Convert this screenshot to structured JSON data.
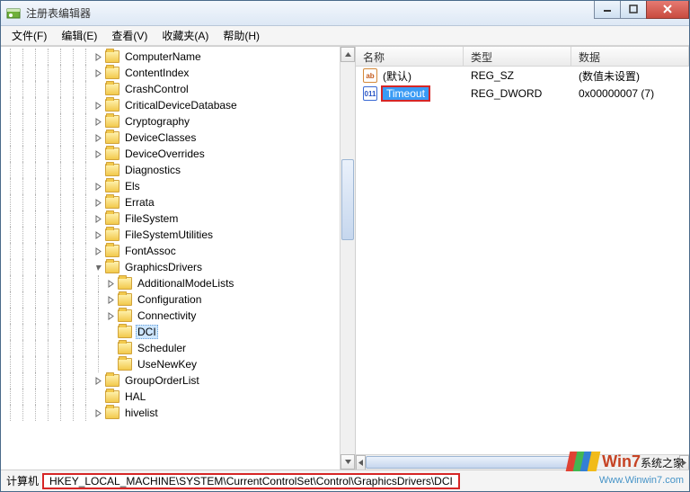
{
  "window": {
    "title": "注册表编辑器"
  },
  "menu": [
    {
      "label": "文件(F)"
    },
    {
      "label": "编辑(E)"
    },
    {
      "label": "查看(V)"
    },
    {
      "label": "收藏夹(A)"
    },
    {
      "label": "帮助(H)"
    }
  ],
  "tree": {
    "nodes": [
      {
        "depth": 7,
        "expand": "closed",
        "label": "ComputerName"
      },
      {
        "depth": 7,
        "expand": "closed",
        "label": "ContentIndex"
      },
      {
        "depth": 7,
        "expand": "none",
        "label": "CrashControl"
      },
      {
        "depth": 7,
        "expand": "closed",
        "label": "CriticalDeviceDatabase"
      },
      {
        "depth": 7,
        "expand": "closed",
        "label": "Cryptography"
      },
      {
        "depth": 7,
        "expand": "closed",
        "label": "DeviceClasses"
      },
      {
        "depth": 7,
        "expand": "closed",
        "label": "DeviceOverrides"
      },
      {
        "depth": 7,
        "expand": "none",
        "label": "Diagnostics"
      },
      {
        "depth": 7,
        "expand": "closed",
        "label": "Els"
      },
      {
        "depth": 7,
        "expand": "closed",
        "label": "Errata"
      },
      {
        "depth": 7,
        "expand": "closed",
        "label": "FileSystem"
      },
      {
        "depth": 7,
        "expand": "closed",
        "label": "FileSystemUtilities"
      },
      {
        "depth": 7,
        "expand": "closed",
        "label": "FontAssoc"
      },
      {
        "depth": 7,
        "expand": "open",
        "label": "GraphicsDrivers"
      },
      {
        "depth": 8,
        "expand": "closed",
        "label": "AdditionalModeLists"
      },
      {
        "depth": 8,
        "expand": "closed",
        "label": "Configuration"
      },
      {
        "depth": 8,
        "expand": "closed",
        "label": "Connectivity"
      },
      {
        "depth": 8,
        "expand": "none",
        "label": "DCI",
        "selected": true
      },
      {
        "depth": 8,
        "expand": "none",
        "label": "Scheduler"
      },
      {
        "depth": 8,
        "expand": "none",
        "label": "UseNewKey"
      },
      {
        "depth": 7,
        "expand": "closed",
        "label": "GroupOrderList"
      },
      {
        "depth": 7,
        "expand": "none",
        "label": "HAL"
      },
      {
        "depth": 7,
        "expand": "closed",
        "label": "hivelist"
      }
    ]
  },
  "list": {
    "columns": {
      "name": "名称",
      "type": "类型",
      "data": "数据"
    },
    "rows": [
      {
        "icon": "sz",
        "name": "(默认)",
        "type": "REG_SZ",
        "data": "(数值未设置)",
        "highlight": false
      },
      {
        "icon": "dw",
        "name": "Timeout",
        "type": "REG_DWORD",
        "data": "0x00000007 (7)",
        "highlight": true
      }
    ]
  },
  "status": {
    "prefix": "计算机",
    "path": "HKEY_LOCAL_MACHINE\\SYSTEM\\CurrentControlSet\\Control\\GraphicsDrivers\\DCI"
  },
  "watermark": {
    "brand_big": "Win7",
    "brand_rest": "系统之家",
    "url": "Www.Winwin7.com"
  }
}
